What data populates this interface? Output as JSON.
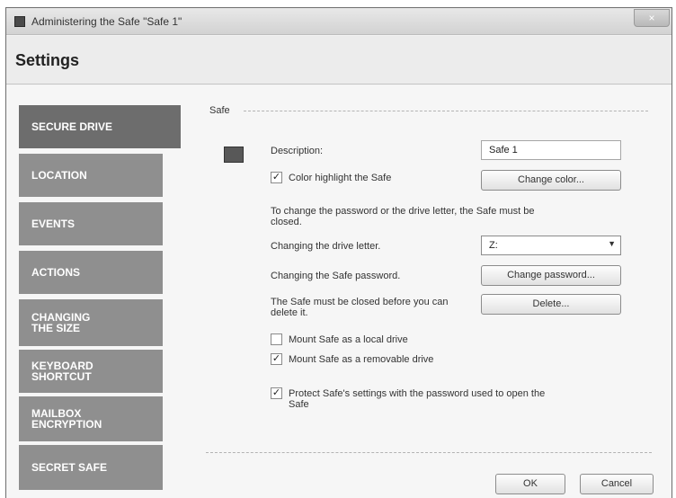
{
  "window": {
    "title": "Administering the Safe \"Safe 1\"",
    "close_label": "×"
  },
  "header": {
    "title": "Settings"
  },
  "sidebar": {
    "items": [
      {
        "label": "SECURE DRIVE",
        "active": true
      },
      {
        "label": "LOCATION",
        "active": false
      },
      {
        "label": "EVENTS",
        "active": false
      },
      {
        "label": "ACTIONS",
        "active": false
      },
      {
        "label": "CHANGING THE SIZE",
        "active": false
      },
      {
        "label": "KEYBOARD SHORTCUT",
        "active": false
      },
      {
        "label": "MAILBOX ENCRYPTION",
        "active": false
      },
      {
        "label": "SECRET SAFE",
        "active": false
      }
    ]
  },
  "panel": {
    "legend": "Safe",
    "description_label": "Description:",
    "description_value": "Safe 1",
    "color_highlight_label": "Color highlight the Safe",
    "color_highlight_checked": "✓",
    "change_color_label": "Change color...",
    "info_text": "To change the password or the drive letter, the Safe must be closed.",
    "drive_letter_label": "Changing the drive letter.",
    "drive_letter_value": "Z:",
    "password_label": "Changing the Safe password.",
    "change_password_label": "Change password...",
    "delete_info": "The Safe must be closed before you can delete it.",
    "delete_label": "Delete...",
    "mount_local_label": "Mount Safe as a local drive",
    "mount_local_checked": "",
    "mount_removable_label": "Mount Safe as a removable drive",
    "mount_removable_checked": "✓",
    "protect_label": "Protect Safe's settings with the password used to open the Safe",
    "protect_checked": "✓"
  },
  "footer": {
    "ok_label": "OK",
    "cancel_label": "Cancel"
  }
}
